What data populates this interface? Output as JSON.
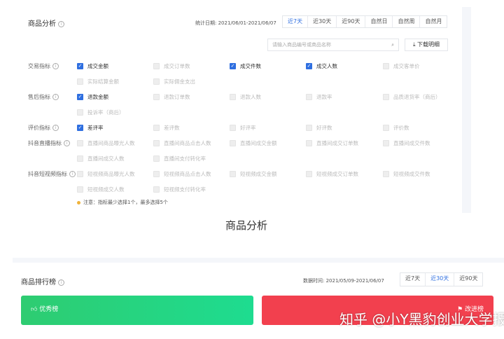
{
  "analysis": {
    "title": "商品分析",
    "date_label": "统计日期: 2021/06/01-2021/06/07",
    "ranges": [
      "近7天",
      "近30天",
      "近90天",
      "自然日",
      "自然周",
      "自然月"
    ],
    "active_range": "近7天",
    "search_placeholder": "请输入商品编号或商品名称",
    "download_label": "下载明细",
    "groups": [
      {
        "label": "交易指标",
        "rows": [
          [
            {
              "t": "成交金额",
              "c": true
            },
            {
              "t": "成交订单数",
              "c": false
            },
            {
              "t": "成交件数",
              "c": true
            },
            {
              "t": "成交人数",
              "c": true
            },
            {
              "t": "成交客单价",
              "c": false
            }
          ],
          [
            {
              "t": "实际结算金额",
              "c": false
            },
            {
              "t": "实际佣金支出",
              "c": false
            }
          ]
        ]
      },
      {
        "label": "售后指标",
        "rows": [
          [
            {
              "t": "退款金额",
              "c": true
            },
            {
              "t": "退款订单数",
              "c": false
            },
            {
              "t": "退款人数",
              "c": false
            },
            {
              "t": "退款率",
              "c": false
            },
            {
              "t": "品质退货率（商后）",
              "c": false
            }
          ],
          [
            {
              "t": "投诉率（商后）",
              "c": false
            }
          ]
        ]
      },
      {
        "label": "评价指标",
        "rows": [
          [
            {
              "t": "差评率",
              "c": true
            },
            {
              "t": "差评数",
              "c": false
            },
            {
              "t": "好评率",
              "c": false
            },
            {
              "t": "好评数",
              "c": false
            },
            {
              "t": "评价数",
              "c": false
            }
          ]
        ]
      },
      {
        "label": "抖音直播指标",
        "rows": [
          [
            {
              "t": "直播间商品曝光人数",
              "c": false
            },
            {
              "t": "直播间商品点击人数",
              "c": false
            },
            {
              "t": "直播间成交金额",
              "c": false
            },
            {
              "t": "直播间成交订单数",
              "c": false
            },
            {
              "t": "直播间成交件数",
              "c": false
            }
          ],
          [
            {
              "t": "直播间成交人数",
              "c": false
            },
            {
              "t": "直播间支付转化率",
              "c": false
            }
          ]
        ]
      },
      {
        "label": "抖音短视频指标",
        "rows": [
          [
            {
              "t": "短视频商品曝光人数",
              "c": false
            },
            {
              "t": "短视频商品点击人数",
              "c": false
            },
            {
              "t": "短视频成交金额",
              "c": false
            },
            {
              "t": "短视频成交订单数",
              "c": false
            },
            {
              "t": "短视频成交件数",
              "c": false
            }
          ],
          [
            {
              "t": "短视频成交人数",
              "c": false
            },
            {
              "t": "短视频支付转化率",
              "c": false
            }
          ]
        ]
      }
    ],
    "note": "注意：指标最少选择1个，最多选择5个"
  },
  "caption": "商品分析",
  "ranking": {
    "title": "商品排行榜",
    "date_label": "数据时间: 2021/05/09-2021/06/07",
    "ranges": [
      "近7天",
      "近30天",
      "近90天"
    ],
    "active_range": "近30天",
    "good_label": "优秀榜",
    "bad_label": "改进榜",
    "good_color": "#2ecc71",
    "bad_color": "#f2404e"
  },
  "watermark": "知乎 @小Y黑豹创业大学报"
}
